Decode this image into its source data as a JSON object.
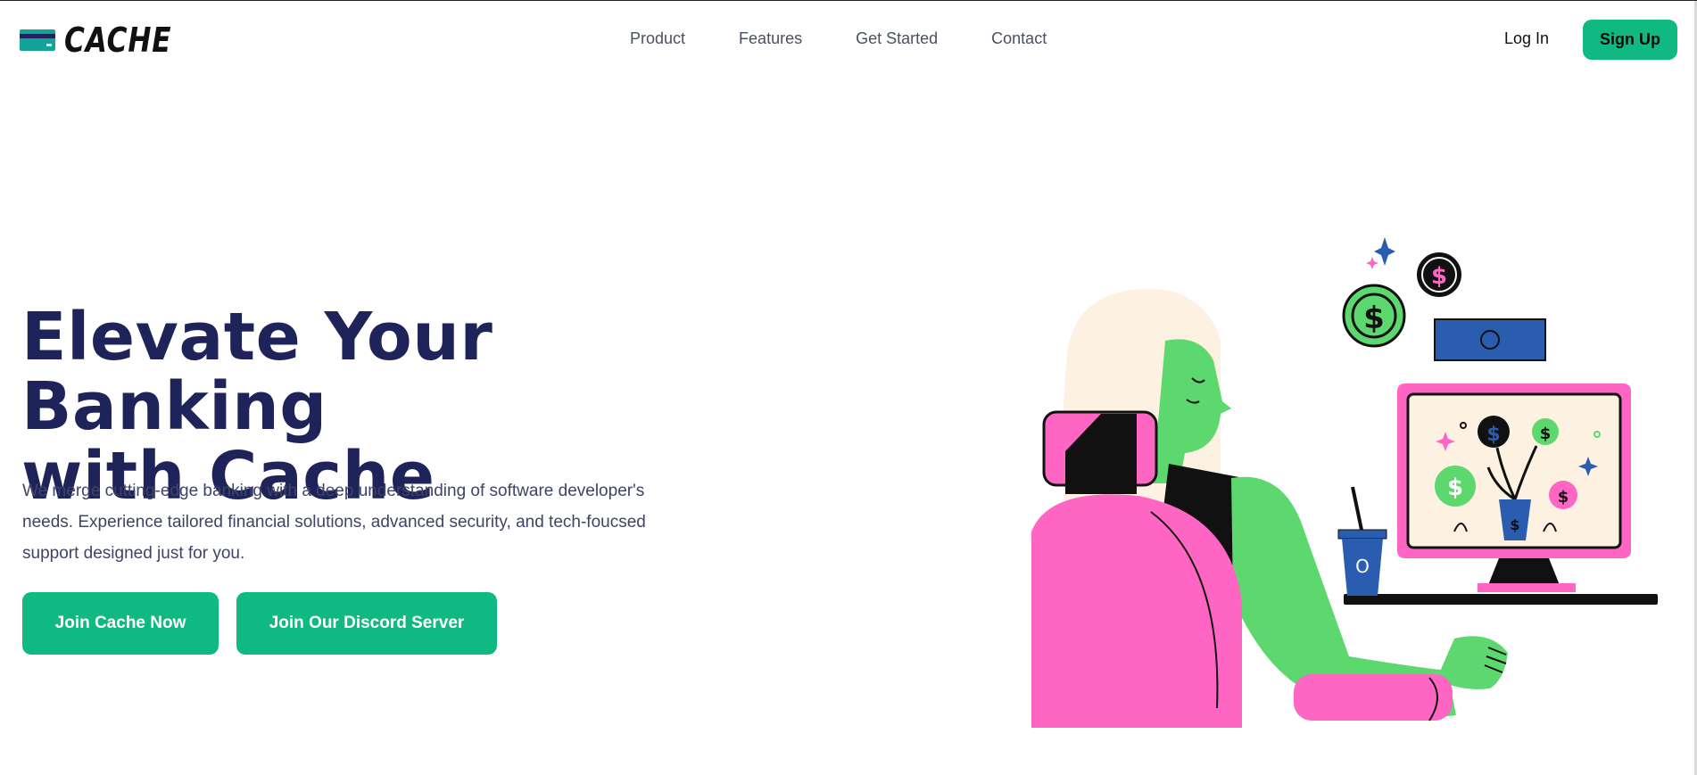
{
  "brand": {
    "name": "CACHE",
    "accent": "#10b981",
    "heading_color": "#1e2459"
  },
  "nav": {
    "links": [
      {
        "label": "Product"
      },
      {
        "label": "Features"
      },
      {
        "label": "Get Started"
      },
      {
        "label": "Contact"
      }
    ]
  },
  "auth": {
    "login_label": "Log In",
    "signup_label": "Sign Up"
  },
  "hero": {
    "title_line1": "Elevate Your Banking",
    "title_line2": "with Cache",
    "description": "We merge cutting-edge banking with a deep understanding of software developer's needs. Experience tailored financial solutions, advanced security, and tech-foucsed support designed just for you.",
    "primary_button": "Join Cache Now",
    "secondary_button": "Join Our Discord Server"
  },
  "illustration": {
    "name": "woman-at-computer-illustration",
    "cup_label": "O"
  },
  "icons": {
    "logo": "credit-card-icon"
  }
}
